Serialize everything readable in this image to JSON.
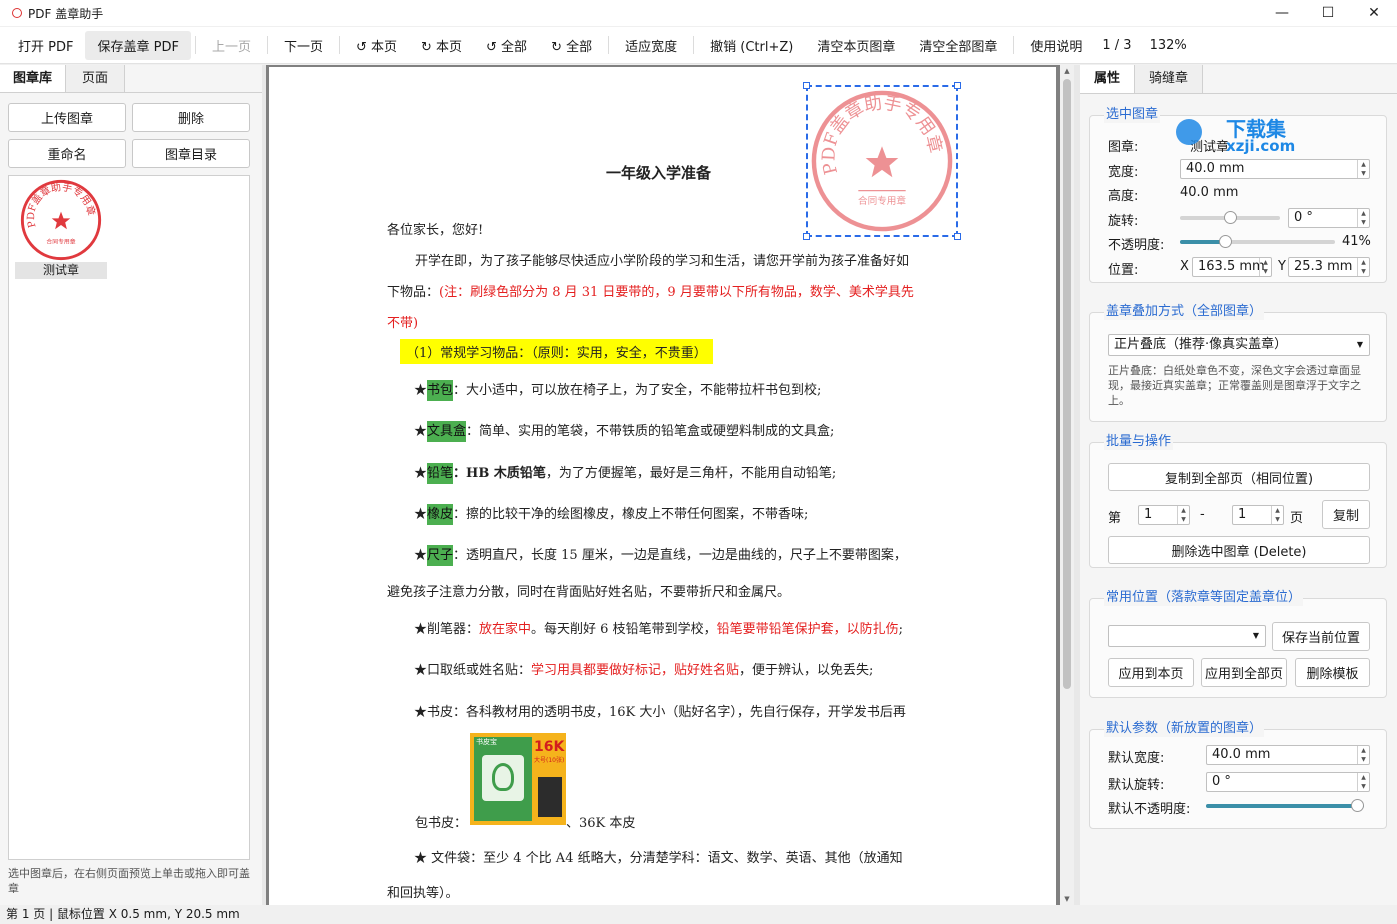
{
  "app": {
    "title": "PDF 盖章助手"
  },
  "window": {
    "minimize": "—",
    "maximize": "☐",
    "close": "✕"
  },
  "toolbar": {
    "open": "打开 PDF",
    "save": "保存盖章 PDF",
    "prev": "上一页",
    "next": "下一页",
    "rotate_page_ccw": "↺ 本页",
    "rotate_page_cw": "↻ 本页",
    "rotate_all_ccw": "↺ 全部",
    "rotate_all_cw": "↻ 全部",
    "fit_width": "适应宽度",
    "undo": "撤销 (Ctrl+Z)",
    "clear_page": "清空本页图章",
    "clear_all": "清空全部图章",
    "help": "使用说明",
    "page_indicator": "1 / 3",
    "zoom": "132%"
  },
  "left": {
    "tabs": [
      "图章库",
      "页面"
    ],
    "upload": "上传图章",
    "delete": "删除",
    "rename": "重命名",
    "catalog": "图章目录",
    "stamps": [
      {
        "name": "测试章"
      }
    ],
    "hint": "选中图章后，在右侧页面预览上单击或拖入即可盖章"
  },
  "stamp": {
    "arc_text": "PDF盖章助手专用章",
    "sub_text": "合同专用章",
    "color": "#e0393e"
  },
  "document": {
    "title": "一年级入学准备",
    "greeting": "各位家长，您好!",
    "intro1": "开学在即，为了孩子能够尽快适应小学阶段的学习和生活，请您开学前为孩子准备好如",
    "intro2a": "下物品：",
    "intro2b": "(注：刷绿色部分为 8 月 31 日要带的，9 月要带以下所有物品，数学、美术学具先",
    "intro3": "不带)",
    "section1": "（1）常规学习物品：（原则：实用，安全，不贵重）",
    "items": [
      {
        "star": "★",
        "tag": "书包",
        "text": "：大小适中，可以放在椅子上，为了安全，不能带拉杆书包到校;"
      },
      {
        "star": "★",
        "tag": "文具盒",
        "text": "：简单、实用的笔袋，不带铁质的铅笔盒或硬塑料制成的文具盒;"
      },
      {
        "star": "★",
        "tag": "铅笔",
        "text_bold": "：HB 木质铅笔",
        "text": "，为了方便握笔，最好是三角杆，不能用自动铅笔;"
      },
      {
        "star": "★",
        "tag": "橡皮",
        "text": "：擦的比较干净的绘图橡皮，橡皮上不带任何图案，不带香味;"
      },
      {
        "star": "★",
        "tag": "尺子",
        "text": "：透明直尺，长度 15 厘米，一边是直线，一边是曲线的，尺子上不要带图案，"
      }
    ],
    "ruler_cont": "避免孩子注意力分散，同时在背面贴好姓名贴，不要带折尺和金属尺。",
    "sharpener_a": "★削笔器：",
    "sharpener_b": "放在家中",
    "sharpener_c": "。每天削好 6 枝铅笔带到学校，",
    "sharpener_d": "铅笔要带铅笔保护套，以防扎伤",
    "sharpener_e": ";",
    "tape_a": "★口取纸或姓名贴：",
    "tape_b": "学习用具都要做好标记，贴好姓名贴",
    "tape_c": "，便于辨认，以免丢失;",
    "cover": "★书皮：各科教材用的透明书皮，16K 大小（贴好名字），先自行保存，开学发书后再",
    "cover2a": "包书皮：",
    "cover2b": "、36K 本皮",
    "folder": "★ 文件袋：至少 4 个比 A4 纸略大，分清楚学科：语文、数学、英语、其他（放通知",
    "folder2": "和回执等）。",
    "book_img": {
      "corner": "16K",
      "sub": "大号(10张)",
      "badge": "书皮宝"
    }
  },
  "right": {
    "tabs": [
      "属性",
      "骑缝章"
    ],
    "selected": {
      "title": "选中图章",
      "name_label": "图章:",
      "name": "测试章",
      "width_label": "宽度:",
      "width": "40.0 mm",
      "height_label": "高度:",
      "height": "40.0 mm",
      "rotate_label": "旋转:",
      "rotate": "0 °",
      "rotate_fraction": 0.5,
      "opacity_label": "不透明度:",
      "opacity": "41%",
      "opacity_fraction": 0.29,
      "pos_label": "位置:",
      "x_label": "X",
      "x": "163.5 mm",
      "y_label": "Y",
      "y": "25.3 mm"
    },
    "overlay": {
      "title": "盖章叠加方式（全部图章）",
      "mode": "正片叠底（推荐·像真实盖章）",
      "desc": "正片叠底：白纸处章色不变，深色文字会透过章面显现，最接近真实盖章；正常覆盖则是图章浮于文字之上。"
    },
    "batch": {
      "title": "批量与操作",
      "copy_all": "复制到全部页（相同位置)",
      "from_label": "第",
      "from": "1",
      "dash": "-",
      "to": "1",
      "page_label": "页",
      "copy": "复制",
      "delete_sel": "删除选中图章 (Delete)"
    },
    "positions": {
      "title": "常用位置（落款章等固定盖章位）",
      "select": "",
      "save": "保存当前位置",
      "apply_page": "应用到本页",
      "apply_all": "应用到全部页",
      "delete_tpl": "删除模板"
    },
    "defaults": {
      "title": "默认参数（新放置的图章）",
      "width_label": "默认宽度:",
      "width": "40.0 mm",
      "rotate_label": "默认旋转:",
      "rotate": "0 °",
      "opacity_label": "默认不透明度:",
      "opacity_fraction": 1.0
    }
  },
  "watermark": {
    "text1": "下载集",
    "text2": "xzji.com"
  },
  "status": {
    "text": "第 1 页 | 鼠标位置 X 0.5 mm, Y 20.5 mm"
  }
}
